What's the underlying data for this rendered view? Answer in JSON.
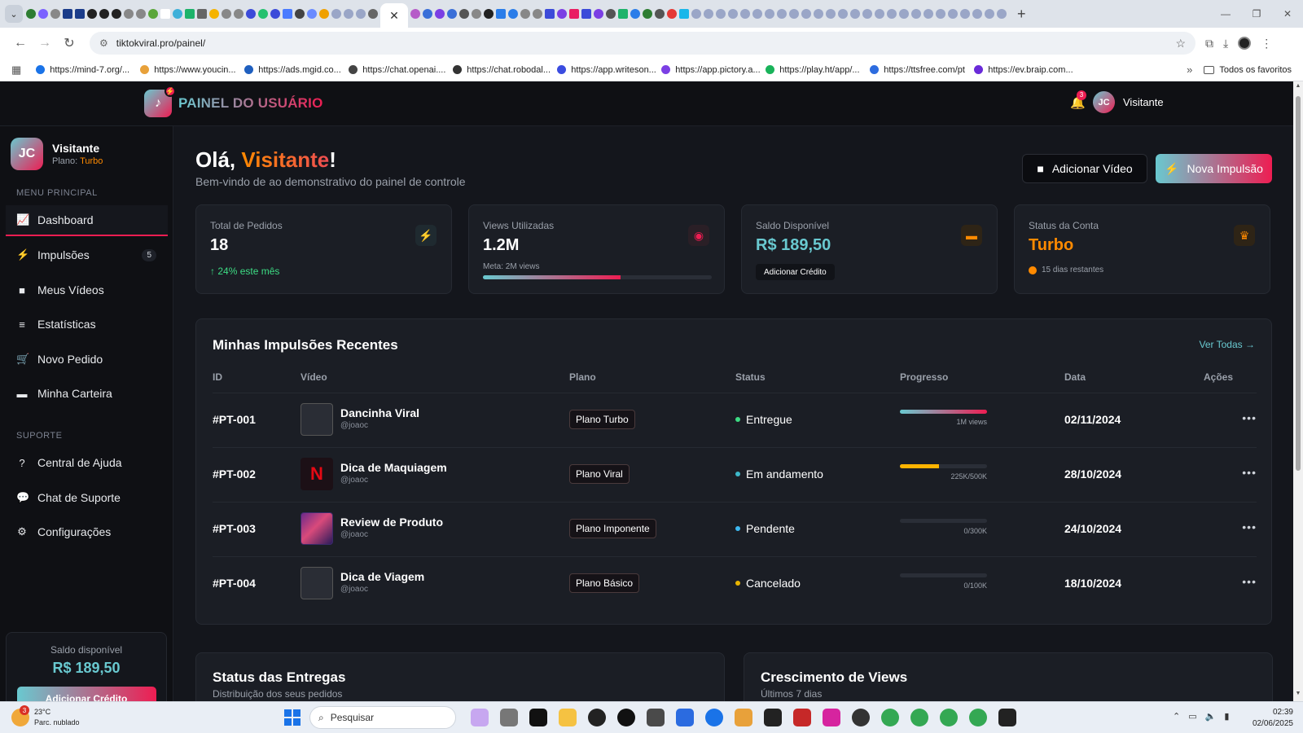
{
  "browser": {
    "url": "tiktokviral.pro/painel/",
    "bookmarks": [
      {
        "label": "https://mind-7.org/...",
        "color": "#1a73e8"
      },
      {
        "label": "https://www.youcin...",
        "color": "#e8a13a"
      },
      {
        "label": "https://ads.mgid.co...",
        "color": "#1f5fbf"
      },
      {
        "label": "https://chat.openai....",
        "color": "#444444"
      },
      {
        "label": "https://chat.robodal...",
        "color": "#333333"
      },
      {
        "label": "https://app.writeson...",
        "color": "#3b4ce0"
      },
      {
        "label": "https://app.pictory.a...",
        "color": "#7b3fe4"
      },
      {
        "label": "https://play.ht/app/...",
        "color": "#19b35a"
      },
      {
        "label": "https://ttsfree.com/pt",
        "color": "#2d6cdf"
      },
      {
        "label": "https://ev.braip.com...",
        "color": "#6a2bd9"
      }
    ],
    "bookmarks_folder": "Todos os favoritos"
  },
  "header": {
    "brand": "PAINEL DO USUÁRIO",
    "notification_count": "3",
    "avatar_initials": "JC",
    "username": "Visitante"
  },
  "sidebar": {
    "user_initials": "JC",
    "user_name": "Visitante",
    "plan_label": "Plano:",
    "plan_value": "Turbo",
    "menu_title": "MENU PRINCIPAL",
    "menu": [
      {
        "label": "Dashboard",
        "icon": "chart-line-icon"
      },
      {
        "label": "Impulsões",
        "icon": "bolt-icon",
        "count": "5"
      },
      {
        "label": "Meus Vídeos",
        "icon": "video-icon"
      },
      {
        "label": "Estatísticas",
        "icon": "bar-chart-icon"
      },
      {
        "label": "Novo Pedido",
        "icon": "cart-icon"
      },
      {
        "label": "Minha Carteira",
        "icon": "wallet-icon"
      }
    ],
    "support_title": "SUPORTE",
    "support": [
      {
        "label": "Central de Ajuda",
        "icon": "help-icon"
      },
      {
        "label": "Chat de Suporte",
        "icon": "chat-icon"
      },
      {
        "label": "Configurações",
        "icon": "gear-icon"
      }
    ],
    "balance_label": "Saldo disponível",
    "balance_value": "R$ 189,50",
    "balance_button": "Adicionar Crédito"
  },
  "main": {
    "greeting_prefix": "Olá, ",
    "greeting_name": "Visitante",
    "greeting_suffix": "!",
    "subtitle": "Bem-vindo de ao demonstrativo do painel de controle",
    "btn_add_video": "Adicionar Vídeo",
    "btn_new_boost": "Nova Impulsão",
    "cards": {
      "orders": {
        "label": "Total de Pedidos",
        "value": "18",
        "trend": "24% este mês"
      },
      "views": {
        "label": "Views Utilizadas",
        "value": "1.2M",
        "meta": "Meta: 2M views",
        "progress": 0.6
      },
      "balance": {
        "label": "Saldo Disponível",
        "value": "R$ 189,50",
        "button": "Adicionar Crédito"
      },
      "status": {
        "label": "Status da Conta",
        "value": "Turbo",
        "days": "15 dias restantes"
      }
    },
    "recent": {
      "title": "Minhas Impulsões Recentes",
      "see_all": "Ver Todas",
      "columns": [
        "ID",
        "Vídeo",
        "Plano",
        "Status",
        "Progresso",
        "Data",
        "Ações"
      ],
      "rows": [
        {
          "id": "#PT-001",
          "video": "Dancinha Viral",
          "handle": "@joaoc",
          "plan": "Plano Turbo",
          "status": "Entregue",
          "status_color": "#3ddc84",
          "progress": 1.0,
          "progress_label": "1M views",
          "date": "02/11/2024"
        },
        {
          "id": "#PT-002",
          "video": "Dica de Maquiagem",
          "handle": "@joaoc",
          "plan": "Plano Viral",
          "status": "Em andamento",
          "status_color": "#3db8c9",
          "progress": 0.45,
          "progress_label": "225K/500K",
          "date": "28/10/2024"
        },
        {
          "id": "#PT-003",
          "video": "Review de Produto",
          "handle": "@joaoc",
          "plan": "Plano Imponente",
          "status": "Pendente",
          "status_color": "#3db8f0",
          "progress": 0,
          "progress_label": "0/300K",
          "date": "24/10/2024"
        },
        {
          "id": "#PT-004",
          "video": "Dica de Viagem",
          "handle": "@joaoc",
          "plan": "Plano Básico",
          "status": "Cancelado",
          "status_color": "#e8b400",
          "progress": 0,
          "progress_label": "0/100K",
          "date": "18/10/2024"
        }
      ]
    },
    "delivery": {
      "title": "Status das Entregas",
      "subtitle": "Distribuição dos seus pedidos"
    },
    "growth": {
      "title": "Crescimento de Views",
      "subtitle": "Últimos 7 dias"
    }
  },
  "taskbar": {
    "weather_badge": "3",
    "temp": "23°C",
    "condition": "Parc. nublado",
    "search_placeholder": "Pesquisar",
    "time": "02:39",
    "date": "02/06/2025"
  },
  "colors": {
    "accent_cyan": "#69c9d0",
    "accent_pink": "#ee1d52",
    "accent_orange": "#ff8a00"
  }
}
